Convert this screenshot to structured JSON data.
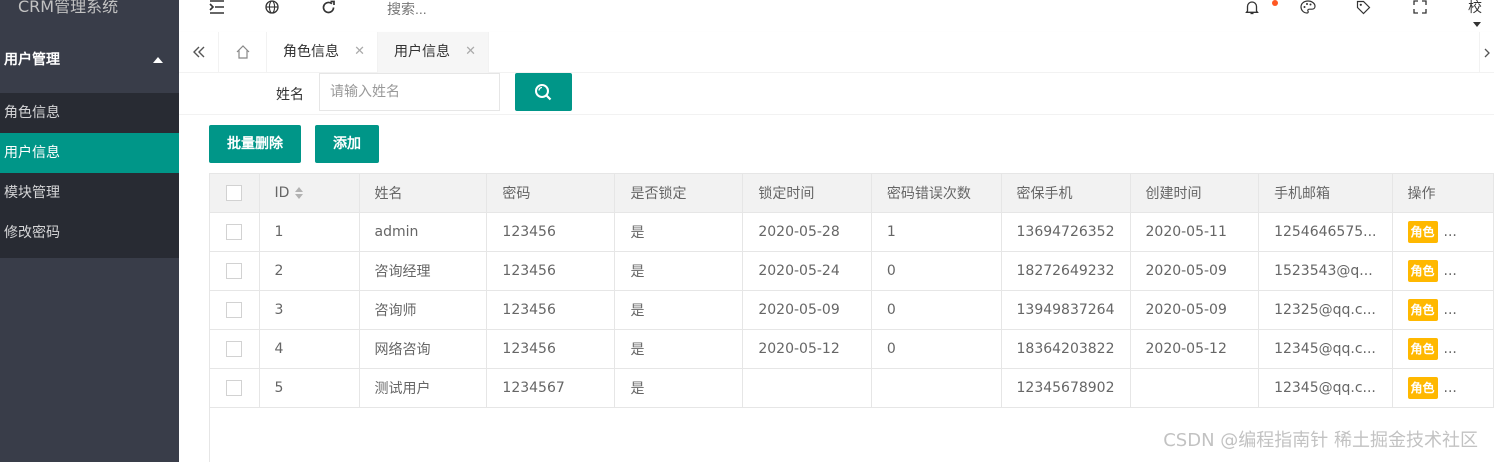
{
  "app": {
    "title": "CRM管理系统"
  },
  "sidebar": {
    "group_label": "用户管理",
    "items": [
      {
        "label": "角色信息",
        "active": false
      },
      {
        "label": "用户信息",
        "active": true
      },
      {
        "label": "模块管理",
        "active": false
      },
      {
        "label": "修改密码",
        "active": false
      }
    ]
  },
  "header": {
    "search_placeholder": "搜索...",
    "user_label": "校",
    "icons": [
      "menu-fold-icon",
      "globe-icon",
      "refresh-icon",
      "bell-icon",
      "palette-icon",
      "tag-icon",
      "fullscreen-icon"
    ]
  },
  "tabs": [
    {
      "label": "角色信息",
      "active": false
    },
    {
      "label": "用户信息",
      "active": true
    }
  ],
  "search": {
    "name_label": "姓名",
    "name_placeholder": "请输入姓名"
  },
  "toolbar": {
    "batch_delete_label": "批量删除",
    "add_label": "添加"
  },
  "table": {
    "columns": [
      "ID",
      "姓名",
      "密码",
      "是否锁定",
      "锁定时间",
      "密码错误次数",
      "密保手机",
      "创建时间",
      "手机邮箱",
      "操作"
    ],
    "rows": [
      {
        "id": "1",
        "name": "admin",
        "password": "123456",
        "locked": "是",
        "lock_time": "2020-05-28",
        "error_count": "1",
        "phone": "13694726352",
        "created": "2020-05-11",
        "email": "1254646575..."
      },
      {
        "id": "2",
        "name": "咨询经理",
        "password": "123456",
        "locked": "是",
        "lock_time": "2020-05-24",
        "error_count": "0",
        "phone": "18272649232",
        "created": "2020-05-09",
        "email": "1523543@q..."
      },
      {
        "id": "3",
        "name": "咨询师",
        "password": "123456",
        "locked": "是",
        "lock_time": "2020-05-09",
        "error_count": "0",
        "phone": "13949837264",
        "created": "2020-05-09",
        "email": "12325@qq.c..."
      },
      {
        "id": "4",
        "name": "网络咨询",
        "password": "123456",
        "locked": "是",
        "lock_time": "2020-05-12",
        "error_count": "0",
        "phone": "18364203822",
        "created": "2020-05-12",
        "email": "12345@qq.c..."
      },
      {
        "id": "5",
        "name": "测试用户",
        "password": "1234567",
        "locked": "是",
        "lock_time": "",
        "error_count": "",
        "phone": "12345678902",
        "created": "",
        "email": "12345@qq.c..."
      }
    ],
    "action_badge": "角色",
    "action_more": "..."
  },
  "watermark": "CSDN @编程指南针 稀土掘金技术社区",
  "colors": {
    "sidebar_bg": "#393d49",
    "sidebar_sub_bg": "#282b33",
    "accent": "#009688",
    "badge": "#ffb800",
    "notify_dot": "#ff5722"
  }
}
